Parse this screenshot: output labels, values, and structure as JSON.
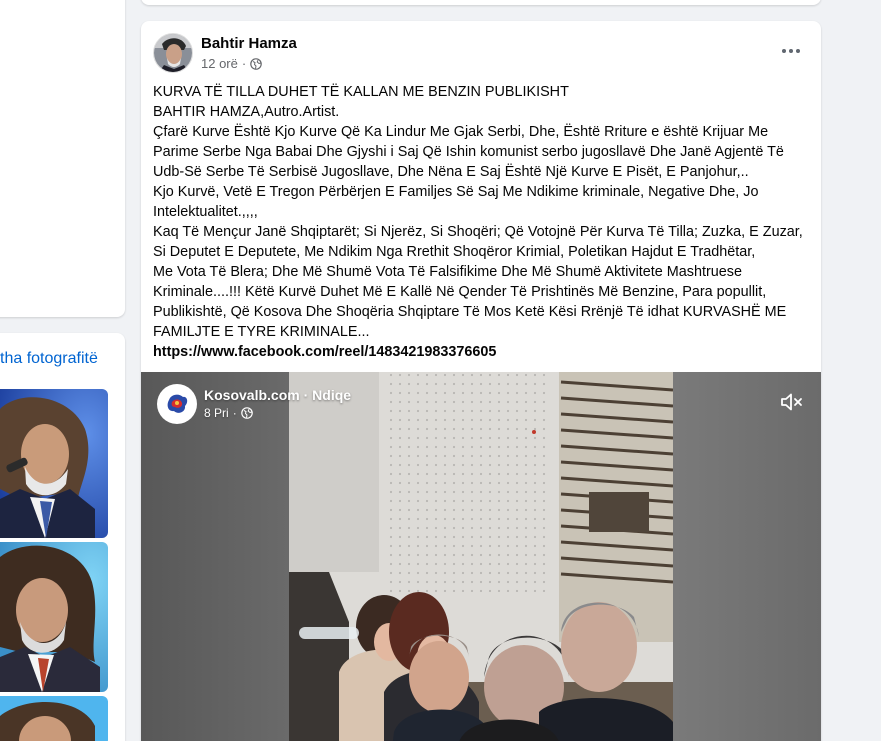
{
  "left_panel": {
    "see_all_photos_label": "tha fotografitë"
  },
  "post": {
    "author": "Bahtir Hamza",
    "time": "12 orë",
    "separator": "·",
    "text_lines": [
      "KURVA TË TILLA DUHET TË KALLAN ME BENZIN PUBLIKISHT",
      "BAHTIR HAMZA,Autro.Artist.",
      "Çfarë Kurve Është Kjo Kurve Që Ka Lindur Me Gjak Serbi, Dhe, Është Rriture e është Krijuar Me",
      "Parime Serbe Nga Babai Dhe Gjyshi i Saj Që Ishin komunist serbo jugosllavë Dhe Janë Agjentë Të",
      "Udb-Së Serbe Të Serbisë Jugosllave, Dhe Nëna E Saj Është Një Kurve E Pisët, E Panjohur,..",
      "Kjo Kurvë, Vetë E Tregon Përbërjen E Familjes Së Saj Me Ndikime kriminale, Negative Dhe, Jo",
      "Intelektualitet.,,,,",
      "Kaq Të Mençur Janë Shqiptarët; Si Njerëz, Si Shoqëri; Që Votojnë Për Kurva Të Tilla; Zuzka, E Zuzar,",
      "Si Deputet E Deputete,  Me Ndikim Nga Rrethit Shoqëror Krimial, Poletikan Hajdut E  Tradhëtar,",
      "Me Vota Të Blera; Dhe Më Shumë Vota Të Falsifikime  Dhe Më Shumë Aktivitete Mashtruese",
      "Kriminale....!!! Këtë Kurvë Duhet Më E Kallë Në Qender Të Prishtinës Më Benzine, Para popullit,",
      "Publikishtë, Që Kosova Dhe Shoqëria Shqiptare Të Mos Ketë Kësi Rrënjë Të idhat KURVASHË ME",
      "FAMILJTE E TYRE KRIMINALE..."
    ],
    "link": "https://www.facebook.com/reel/1483421983376605"
  },
  "video": {
    "page_name": "Kosovalb.com",
    "separator": " · ",
    "follow_label": "Ndiqe",
    "time": "8 Pri",
    "meta_separator": "·"
  },
  "icons": {
    "more": "more-horizontal-icon",
    "audience": "globe-icon",
    "mute": "speaker-muted-icon"
  },
  "colors": {
    "link_blue": "#0064d1",
    "secondary_text": "#65676b",
    "background": "#f0f2f5"
  }
}
